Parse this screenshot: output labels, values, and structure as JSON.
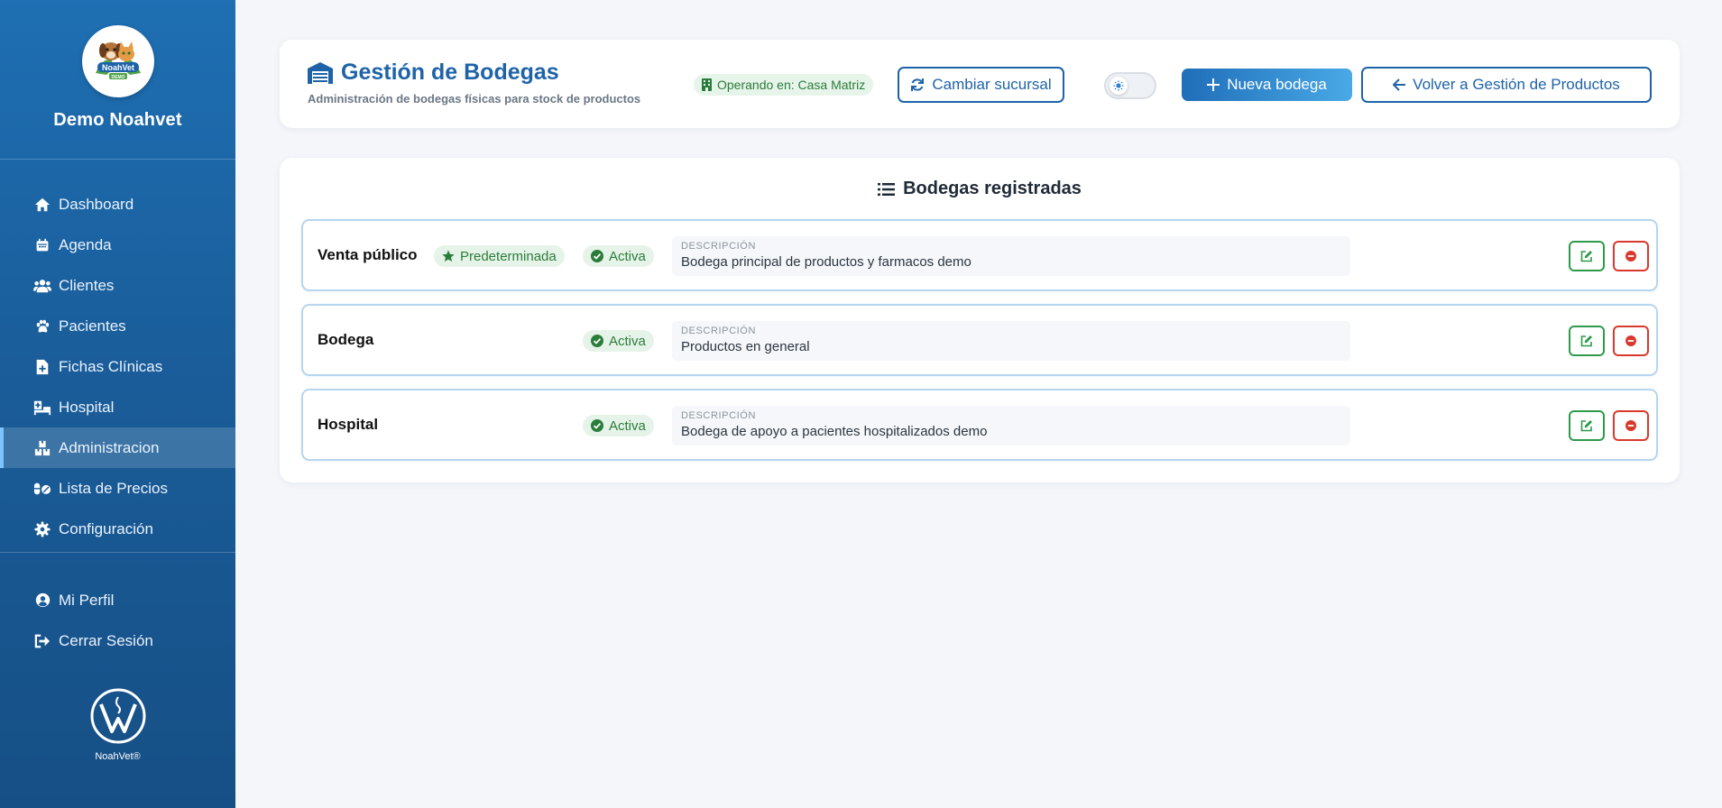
{
  "sidebar": {
    "brand_name": "Demo Noahvet",
    "logo_text": "NoahVet",
    "logo_sub": "DEMO",
    "items": [
      {
        "label": "Dashboard",
        "icon": "home-icon"
      },
      {
        "label": "Agenda",
        "icon": "calendar-icon"
      },
      {
        "label": "Clientes",
        "icon": "users-icon"
      },
      {
        "label": "Pacientes",
        "icon": "paw-icon"
      },
      {
        "label": "Fichas Clínicas",
        "icon": "file-medical-icon"
      },
      {
        "label": "Hospital",
        "icon": "hospital-bed-icon"
      },
      {
        "label": "Administracion",
        "icon": "boxes-icon",
        "active": true
      },
      {
        "label": "Lista de Precios",
        "icon": "pills-icon"
      },
      {
        "label": "Configuración",
        "icon": "gear-icon"
      }
    ],
    "bottom_items": [
      {
        "label": "Mi Perfil",
        "icon": "user-circle-icon"
      },
      {
        "label": "Cerrar Sesión",
        "icon": "sign-out-icon"
      }
    ],
    "footer_name": "NoahVet®"
  },
  "header": {
    "title": "Gestión de Bodegas",
    "subtitle": "Administración de bodegas físicas para stock de productos",
    "branch_badge": "Operando en: Casa Matriz",
    "switch_branch_label": "Cambiar sucursal",
    "new_label": "Nueva bodega",
    "back_label": "Volver a Gestión de Productos"
  },
  "list": {
    "title": "Bodegas registradas",
    "desc_label": "DESCRIPCIÓN",
    "default_badge": "Predeterminada",
    "active_badge": "Activa",
    "rows": [
      {
        "name": "Venta público",
        "is_default": true,
        "status": "Activa",
        "description": "Bodega principal de productos y farmacos demo"
      },
      {
        "name": "Bodega",
        "is_default": false,
        "status": "Activa",
        "description": "Productos en general"
      },
      {
        "name": "Hospital",
        "is_default": false,
        "status": "Activa",
        "description": "Bodega de apoyo a pacientes hospitalizados demo"
      }
    ]
  },
  "colors": {
    "primary": "#1e63a8",
    "success": "#2a7d3a",
    "danger": "#d9392d",
    "sidebar": "#1a5d9a"
  }
}
